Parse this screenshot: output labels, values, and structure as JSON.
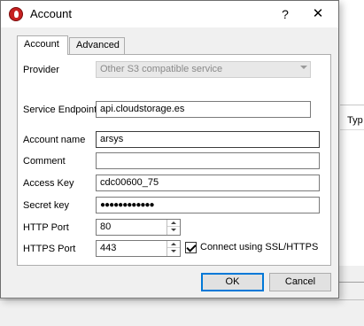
{
  "window": {
    "title": "Account",
    "help_label": "?",
    "close_label": "✕"
  },
  "tabs": [
    {
      "label": "Account"
    },
    {
      "label": "Advanced"
    }
  ],
  "form": {
    "provider": {
      "label": "Provider",
      "value": "Other S3 compatible service"
    },
    "service_endpoint": {
      "label": "Service Endpoint",
      "value": "api.cloudstorage.es"
    },
    "account_name": {
      "label": "Account name",
      "value": "arsys"
    },
    "comment": {
      "label": "Comment",
      "value": ""
    },
    "access_key": {
      "label": "Access Key",
      "value": "cdc00600_75"
    },
    "secret_key": {
      "label": "Secret key",
      "value": "●●●●●●●●●●●●"
    },
    "http_port": {
      "label": "HTTP Port",
      "value": "80"
    },
    "https_port": {
      "label": "HTTPS Port",
      "value": "443"
    },
    "ssl": {
      "label": "Connect using SSL/HTTPS",
      "checked": true
    }
  },
  "buttons": {
    "ok": "OK",
    "cancel": "Cancel"
  },
  "background": {
    "column_header": "Typ"
  },
  "colors": {
    "accent": "#0078d7",
    "dialog_bg": "#f0f0f0",
    "app_icon": "#c62020"
  },
  "icons": {
    "app": "app-logo-icon",
    "help": "help-icon",
    "close": "close-icon"
  }
}
